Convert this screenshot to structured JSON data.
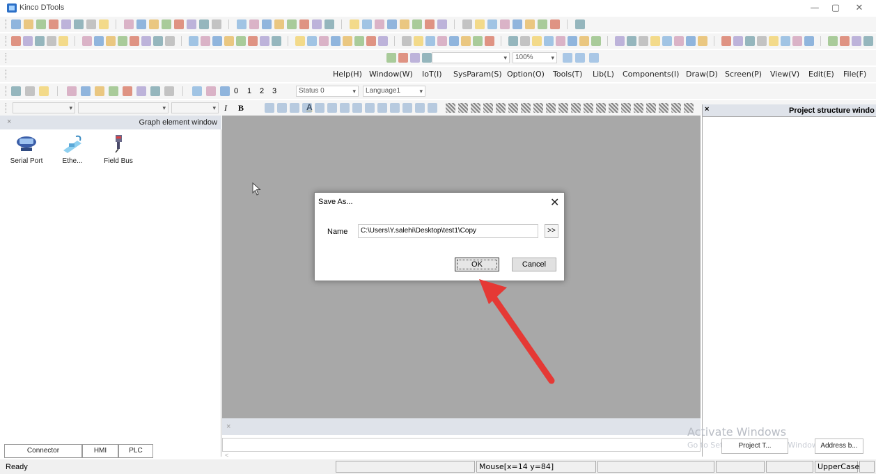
{
  "window": {
    "title": "Kinco DTools",
    "minimize": "—",
    "maximize": "▢",
    "close": "✕"
  },
  "toolbar": {
    "zoom": "100%",
    "states": [
      "0",
      "1",
      "2",
      "3"
    ],
    "status_dropdown": "Status 0",
    "language_dropdown": "Language1",
    "text_italic": "I",
    "text_bold": "B",
    "text_color": "A"
  },
  "menu": {
    "items": [
      "Help(H)",
      "Window(W)",
      "IoT(I)",
      "SysParam(S)",
      "Option(O)",
      "Tools(T)",
      "Lib(L)",
      "Components(I)",
      "Draw(D)",
      "Screen(P)",
      "View(V)",
      "Edit(E)",
      "File(F)"
    ]
  },
  "left_panel": {
    "title": "Graph element window",
    "close": "×",
    "items": [
      {
        "label": "Serial Port",
        "icon": "serial-port-icon"
      },
      {
        "label": "Ethe...",
        "icon": "ethernet-icon"
      },
      {
        "label": "Field Bus",
        "icon": "field-bus-icon"
      }
    ],
    "tabs": [
      "Connector",
      "HMI",
      "PLC"
    ]
  },
  "output_panel": {
    "close": "×",
    "scroll_left": "<"
  },
  "right_panel": {
    "title": "Project structure windo",
    "close": "×",
    "tabs": [
      "Project T...",
      "Address b..."
    ]
  },
  "watermark": {
    "line1": "Activate Windows",
    "line2": "Go to Settings to activate Windows."
  },
  "dialog": {
    "title": "Save As...",
    "close": "✕",
    "name_label": "Name",
    "path_value": "C:\\Users\\Y.salehi\\Desktop\\test1\\Copy",
    "browse_label": ">>",
    "ok_label": "OK",
    "cancel_label": "Cancel"
  },
  "status_bar": {
    "ready": "Ready",
    "mouse": "Mouse[x=14  y=84]",
    "case": "UpperCase"
  },
  "colors": {
    "canvas_bg": "#a8a8a8",
    "panel_header": "#dfe3ea",
    "annotation_arrow": "#e53935"
  }
}
